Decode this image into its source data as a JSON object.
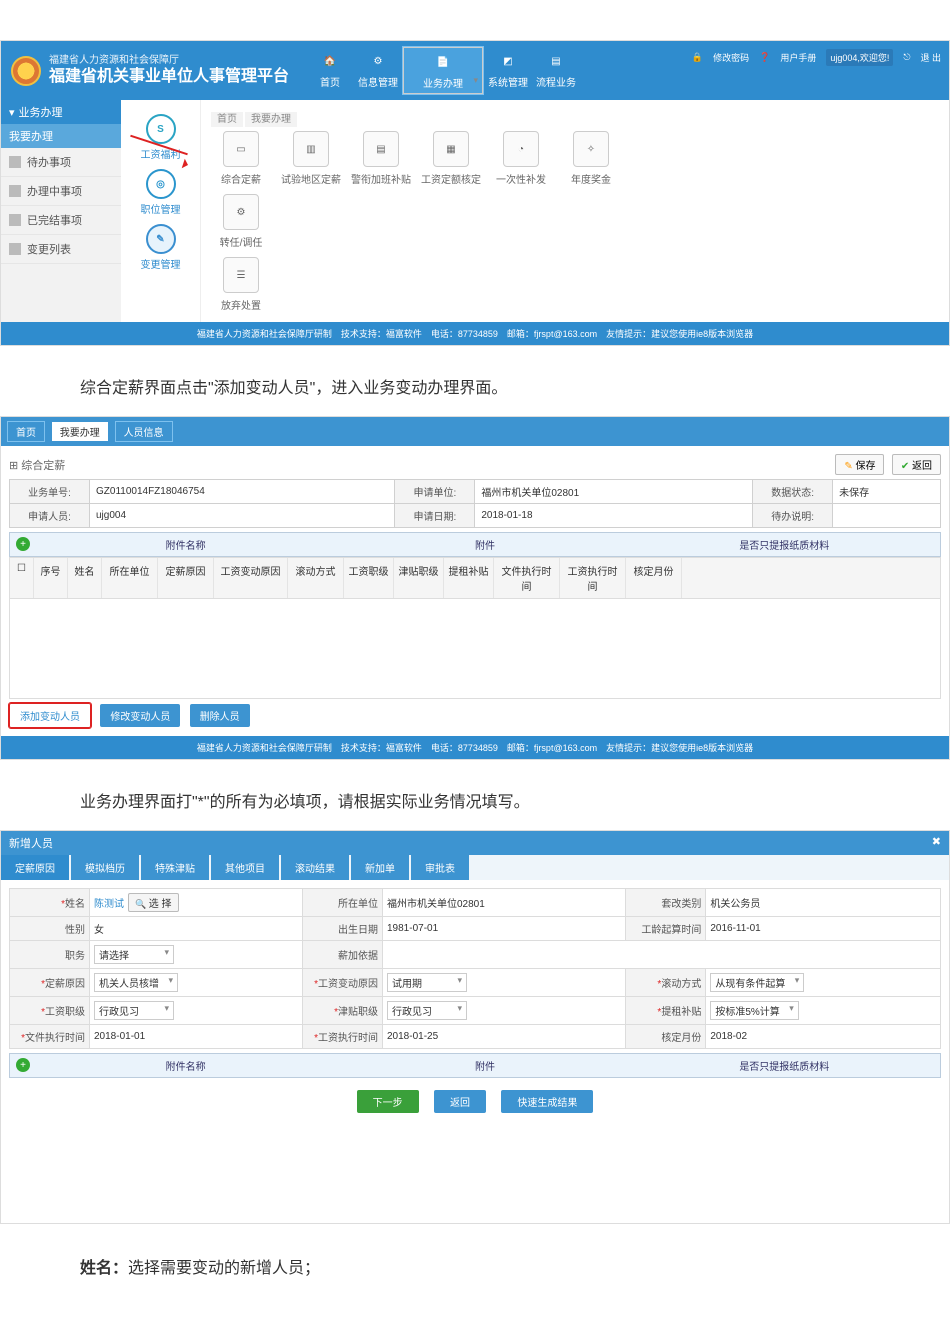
{
  "header": {
    "dept": "福建省人力资源和社会保障厅",
    "platform": "福建省机关事业单位人事管理平台",
    "nav": [
      "首页",
      "信息管理",
      "业务办理",
      "系统管理",
      "流程业务"
    ],
    "nav_sel": 2,
    "right": {
      "pwd": "修改密码",
      "help": "用户手册",
      "user": "ujg004,欢迎您!",
      "exit": "退 出"
    }
  },
  "sidebar": {
    "group": "业务办理",
    "active": "我要办理",
    "items": [
      "待办事项",
      "办理中事项",
      "已完结事项",
      "变更列表"
    ]
  },
  "midcol": [
    {
      "label": "工资福利",
      "glyph": "S"
    },
    {
      "label": "职位管理",
      "glyph": "◎"
    },
    {
      "label": "变更管理",
      "glyph": "✎"
    }
  ],
  "main_tabs": [
    "首页",
    "我要办理"
  ],
  "row1_cards": [
    "综合定薪",
    "试验地区定薪",
    "警衔加班补贴",
    "工资定额核定",
    "一次性补发",
    "年度奖金"
  ],
  "row2_cards": [
    "转任/调任"
  ],
  "row3_cards": [
    "放弃处置"
  ],
  "footer": "福建省人力资源和社会保障厅研制　技术支持：福富软件　电话：87734859　邮箱：fjrspt@163.com　友情提示：建议您使用ie8版本浏览器",
  "caption1": "综合定薪界面点击\"添加变动人员\"，进入业务变动办理界面。",
  "shot2": {
    "tabs": [
      "首页",
      "我要办理",
      "人员信息"
    ],
    "panel_title": "综合定薪",
    "btn_save": "保存",
    "btn_return": "返回",
    "meta": {
      "biz_no_l": "业务单号:",
      "biz_no": "GZ0110014FZ18046754",
      "app_unit_l": "申请单位:",
      "app_unit": "福州市机关单位02801",
      "state_l": "数据状态:",
      "state": "未保存",
      "applicant_l": "申请人员:",
      "applicant": "ujg004",
      "app_date_l": "申请日期:",
      "app_date": "2018-01-18",
      "remark_l": "待办说明:",
      "remark": ""
    },
    "att": {
      "name": "附件名称",
      "file": "附件",
      "paper": "是否只提报纸质材料"
    },
    "cols": [
      "",
      "序号",
      "姓名",
      "所在单位",
      "定薪原因",
      "工资变动原因",
      "滚动方式",
      "工资职级",
      "津贴职级",
      "提租补贴",
      "文件执行时间",
      "工资执行时间",
      "核定月份"
    ],
    "btn_add": "添加变动人员",
    "btn_mod": "修改变动人员",
    "btn_del": "删除人员"
  },
  "caption2": "业务办理界面打\"*\"的所有为必填项，请根据实际业务情况填写。",
  "shot3": {
    "title": "新增人员",
    "tabs": [
      "定薪原因",
      "模拟档历",
      "特殊津贴",
      "其他项目",
      "滚动结果",
      "新加单",
      "审批表"
    ],
    "row1": {
      "name_l": "姓名",
      "name_v": "陈测试",
      "find": "选 择",
      "unit_l": "所在单位",
      "unit_v": "福州市机关单位02801",
      "kind_l": "套改类别",
      "kind_v": "机关公务员"
    },
    "row2": {
      "sex_l": "性别",
      "sex_v": "女",
      "dob_l": "出生日期",
      "dob_v": "1981-07-01",
      "start_l": "工龄起算时间",
      "start_v": "2016-11-01"
    },
    "row3": {
      "job_l": "职务",
      "job_v": "请选择",
      "basis_l": "薪加依据",
      "basis_v": ""
    },
    "row4": {
      "reason_l": "定薪原因",
      "reason_v": "机关人员核增",
      "chg_l": "工资变动原因",
      "chg_v": "试用期",
      "roll_l": "滚动方式",
      "roll_v": "从现有条件起算"
    },
    "row5": {
      "pay_l": "工资职级",
      "pay_v": "行政见习",
      "allow_l": "津贴职级",
      "allow_v": "行政见习",
      "rent_l": "提租补贴",
      "rent_v": "按标准5%计算"
    },
    "row6": {
      "doc_l": "文件执行时间",
      "doc_v": "2018-01-01",
      "exec_l": "工资执行时间",
      "exec_v": "2018-01-25",
      "mon_l": "核定月份",
      "mon_v": "2018-02"
    },
    "att": {
      "name": "附件名称",
      "file": "附件",
      "paper": "是否只提报纸质材料"
    },
    "btn_next": "下一步",
    "btn_back": "返回",
    "btn_quick": "快速生成结果"
  },
  "final_label": "姓名：",
  "final_text": "选择需要变动的新增人员；"
}
